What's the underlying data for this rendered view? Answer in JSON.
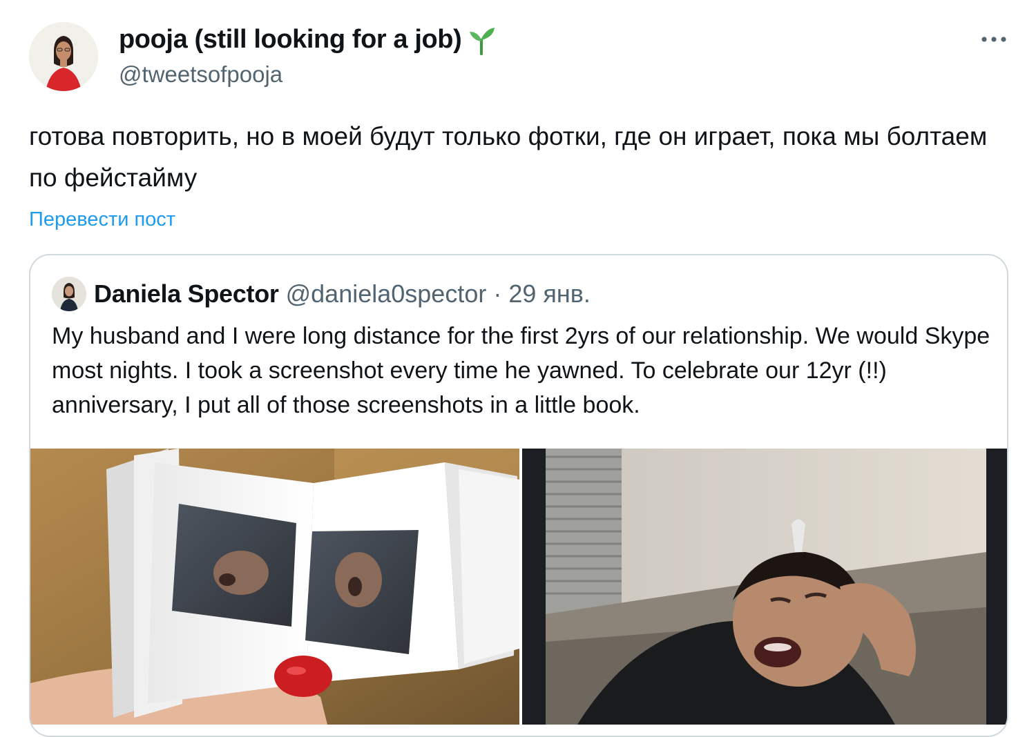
{
  "author": {
    "display_name": "pooja (still looking for a job)",
    "handle": "@tweetsofpooja",
    "name_emoji_icon": "seedling-icon"
  },
  "tweet": {
    "text": "готова повторить, но в моей будут только фотки, где он играет, пока мы болтаем по фейстайму",
    "translate_label": "Перевести пост"
  },
  "quoted_tweet": {
    "display_name": "Daniela Spector",
    "handle": "@daniela0spector",
    "separator": "·",
    "date": "29 янв.",
    "text": "My husband and I were long distance for the first 2yrs of our relationship. We would Skype most nights. I took a screenshot every time he yawned. To celebrate our 12yr (!!) anniversary, I put all of those screenshots in a little book.",
    "media": [
      {
        "icon": "photo-book-image"
      },
      {
        "icon": "video-call-yawn-image"
      }
    ]
  },
  "colors": {
    "link": "#1d9bf0",
    "secondary_text": "#536471",
    "border": "#cfd9de",
    "primary_text": "#0f1419"
  }
}
